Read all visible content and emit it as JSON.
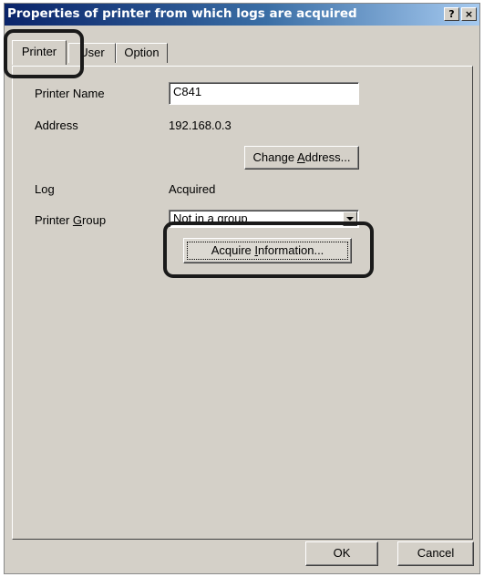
{
  "window": {
    "title": "Properties of printer from which logs are acquired",
    "help_label": "?",
    "close_label": "×"
  },
  "tabs": [
    {
      "label": "Printer",
      "active": true
    },
    {
      "label": "User",
      "active": false
    },
    {
      "label": "Option",
      "active": false
    }
  ],
  "printer": {
    "name_label": "Printer Name",
    "name_value": "C841",
    "address_label": "Address",
    "address_value": "192.168.0.3",
    "change_address_prefix": "Change ",
    "change_address_mnemonic": "A",
    "change_address_suffix": "ddress...",
    "log_label": "Log",
    "log_value": "Acquired",
    "group_label_prefix": "Printer ",
    "group_label_mnemonic": "G",
    "group_label_suffix": "roup",
    "group_value": "Not in a group",
    "acquire_prefix": "Acquire ",
    "acquire_mnemonic": "I",
    "acquire_suffix": "nformation..."
  },
  "footer": {
    "ok_label": "OK",
    "cancel_label": "Cancel"
  },
  "colors": {
    "title_gradient_start": "#0a246a",
    "title_gradient_end": "#a6caf0",
    "dialog_face": "#d4d0c8",
    "callout_outline": "#1a1a1a"
  }
}
